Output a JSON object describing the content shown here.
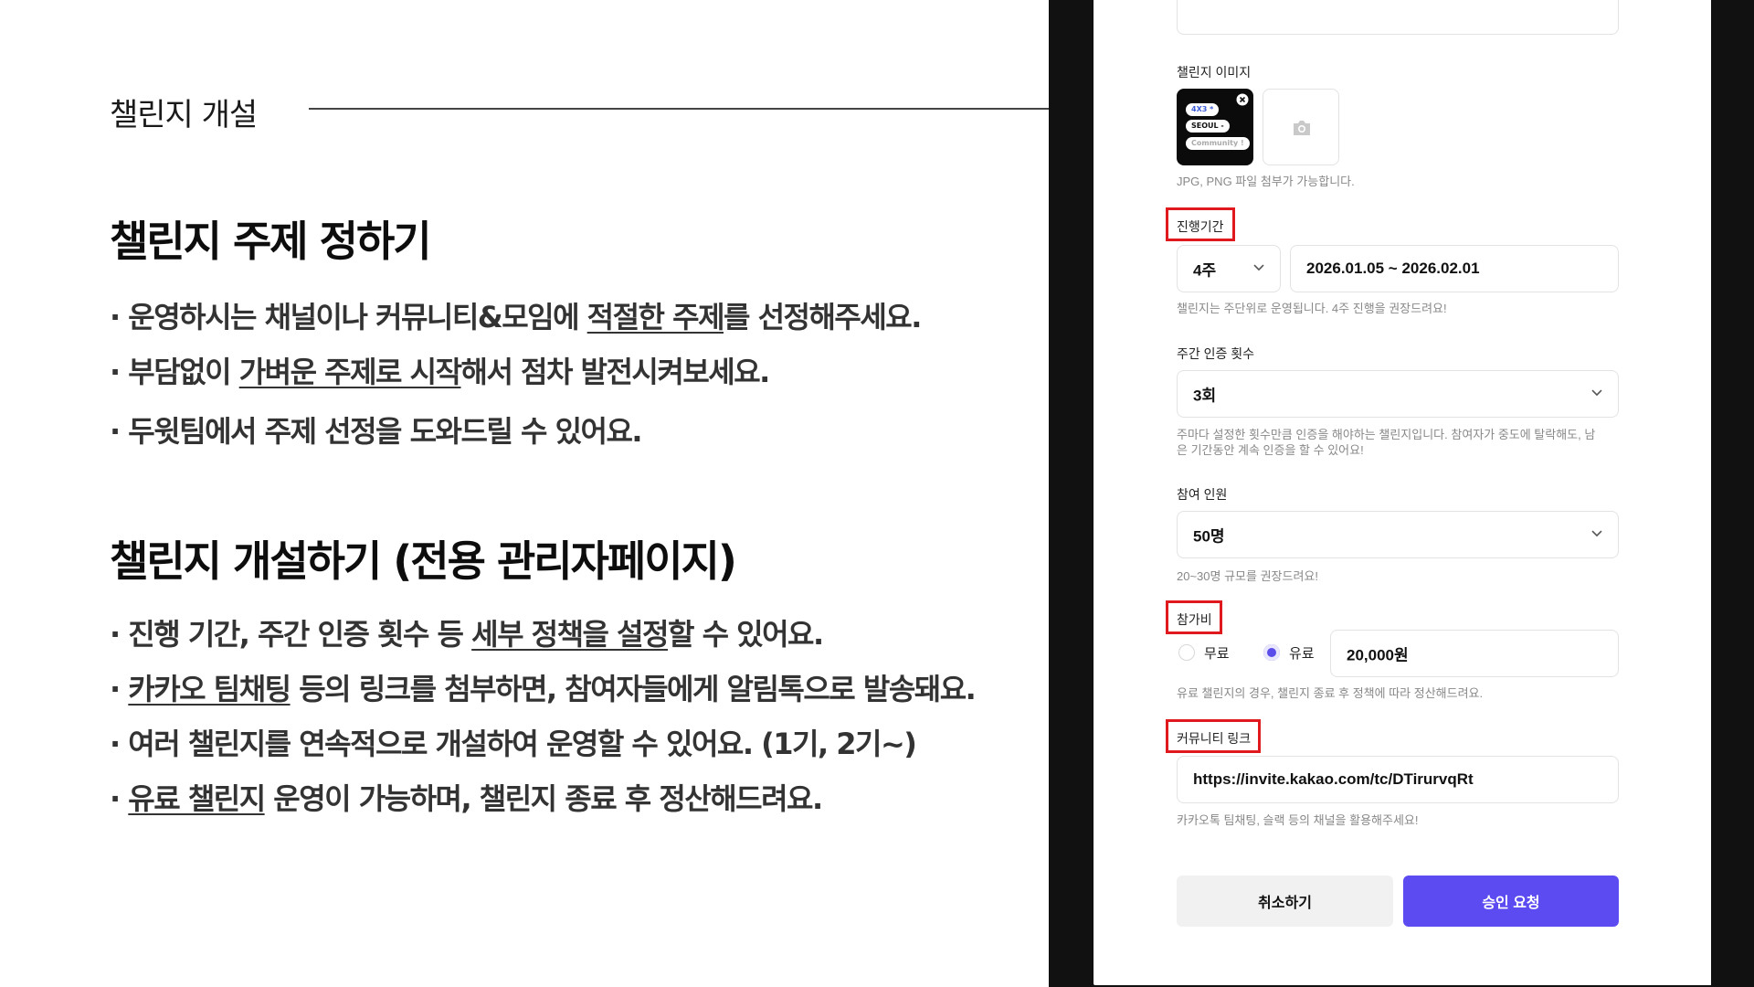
{
  "slide": {
    "heading": "챌린지 개설",
    "section1": {
      "title": "챌린지 주제 정하기",
      "bullets": [
        [
          "· 운영하시는 채널이나 커뮤니티&모임에 ",
          "적절한 주제",
          "를 선정해주세요."
        ],
        [
          "· 부담없이 ",
          "가벼운 주제로 시작",
          "해서 점차 발전시켜보세요."
        ],
        [
          "· 두윗팀에서 주제 선정을 도와드릴 수 있어요.",
          "",
          ""
        ]
      ]
    },
    "section2": {
      "title": "챌린지 개설하기 (전용 관리자페이지)",
      "bullets": [
        [
          "· 진행 기간, 주간 인증 횟수 등 ",
          "세부 정책을 설정",
          "할 수 있어요."
        ],
        [
          "· ",
          "카카오 팀채팅",
          " 등의 링크를 첨부하면, 참여자들에게 알림톡으로 발송돼요."
        ],
        [
          "· 여러 챌린지를 연속적으로 개설하여 운영할 수 있어요. (1기, 2기~)",
          "",
          ""
        ],
        [
          "· ",
          "유료 챌린지",
          " 운영이 가능하며, 챌린지 종료 후 정산해드려요."
        ]
      ]
    }
  },
  "form": {
    "image": {
      "label": "챌린지 이미지",
      "help": "JPG, PNG 파일 첨부가 가능합니다.",
      "thumb_tags": [
        "4X3 *",
        "SEOUL -",
        "Community !"
      ]
    },
    "period": {
      "label": "진행기간",
      "weeks": "4주",
      "dates": "2026.01.05 ~ 2026.02.01",
      "help": "챌린지는 주단위로 운영됩니다. 4주 진행을 권장드려요!"
    },
    "weekly": {
      "label": "주간 인증 횟수",
      "value": "3회",
      "help_line1": "주마다 설정한 횟수만큼 인증을 해야하는 챌린지입니다. 참여자가 중도에 탈락해도, 남",
      "help_line2": "은 기간동안 계속 인증을 할 수 있어요!"
    },
    "members": {
      "label": "참여 인원",
      "value": "50명",
      "help": "20~30명 규모를 권장드려요!"
    },
    "fee": {
      "label": "참가비",
      "free": "무료",
      "paid": "유료",
      "selected": "paid",
      "amount": "20,000원",
      "help": "유료 챌린지의 경우, 챌린지 종료 후 정책에 따라 정산해드려요."
    },
    "link": {
      "label": "커뮤니티 링크",
      "value": "https://invite.kakao.com/tc/DTirurvqRt",
      "help": "카카오톡 팀채팅, 슬랙 등의 채널을 활용해주세요!"
    },
    "buttons": {
      "cancel": "취소하기",
      "submit": "승인 요청"
    },
    "colors": {
      "accent": "#5b4bf0",
      "highlight": "#e0191f"
    },
    "icons": {
      "camera": "camera-icon",
      "remove": "close-icon",
      "dropdown": "chevron-down-icon"
    }
  }
}
